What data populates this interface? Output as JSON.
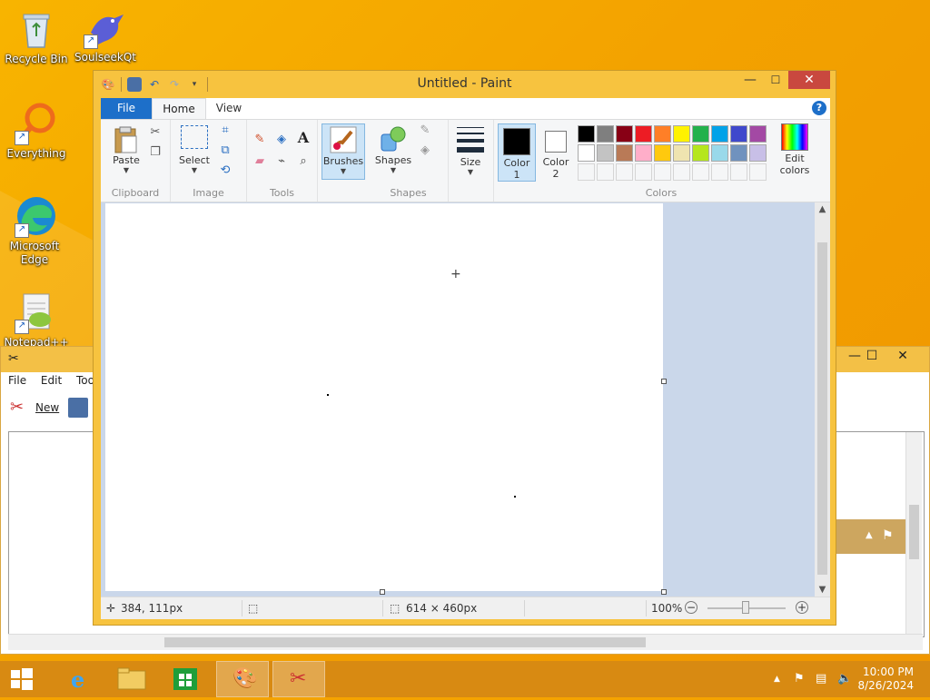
{
  "desktop": {
    "icons": [
      {
        "label": "Recycle Bin",
        "icon": "recycle-bin-icon"
      },
      {
        "label": "SoulseekQt",
        "icon": "soulseek-bird-icon"
      },
      {
        "label": "Everything",
        "icon": "everything-search-icon"
      },
      {
        "label": "Microsoft Edge",
        "icon": "edge-icon"
      },
      {
        "label": "Notepad++",
        "icon": "notepadpp-icon"
      }
    ]
  },
  "bg_window": {
    "menu": [
      "File",
      "Edit",
      "Too"
    ],
    "new_label": "New"
  },
  "paint": {
    "title": "Untitled - Paint",
    "tabs": {
      "file": "File",
      "home": "Home",
      "view": "View"
    },
    "ribbon": {
      "clipboard": {
        "paste": "Paste",
        "group": "Clipboard"
      },
      "image": {
        "select": "Select",
        "group": "Image"
      },
      "tools": {
        "group": "Tools",
        "text_glyph": "A"
      },
      "brushes": {
        "label": "Brushes"
      },
      "shapes": {
        "label": "Shapes",
        "group": "Shapes"
      },
      "size": {
        "label": "Size"
      },
      "colors": {
        "color1_line1": "Color",
        "color1_line2": "1",
        "color2_line1": "Color",
        "color2_line2": "2",
        "group": "Colors",
        "edit_line1": "Edit",
        "edit_line2": "colors",
        "color1_value": "#000000",
        "color2_value": "#ffffff",
        "palette_row1": [
          "#000000",
          "#7f7f7f",
          "#880015",
          "#ed1c24",
          "#ff7f27",
          "#fff200",
          "#22b14c",
          "#00a2e8",
          "#3f48cc",
          "#a349a4"
        ],
        "palette_row2": [
          "#ffffff",
          "#c3c3c3",
          "#b97a57",
          "#ffaec9",
          "#ffc90e",
          "#efe4b0",
          "#b5e61d",
          "#99d9ea",
          "#7092be",
          "#c8bfe7"
        ]
      }
    },
    "status": {
      "cursor_pos": "384, 111px",
      "canvas_size": "614 × 460px",
      "zoom": "100%"
    }
  },
  "taskbar": {
    "time": "10:00 PM",
    "date": "8/26/2024"
  }
}
